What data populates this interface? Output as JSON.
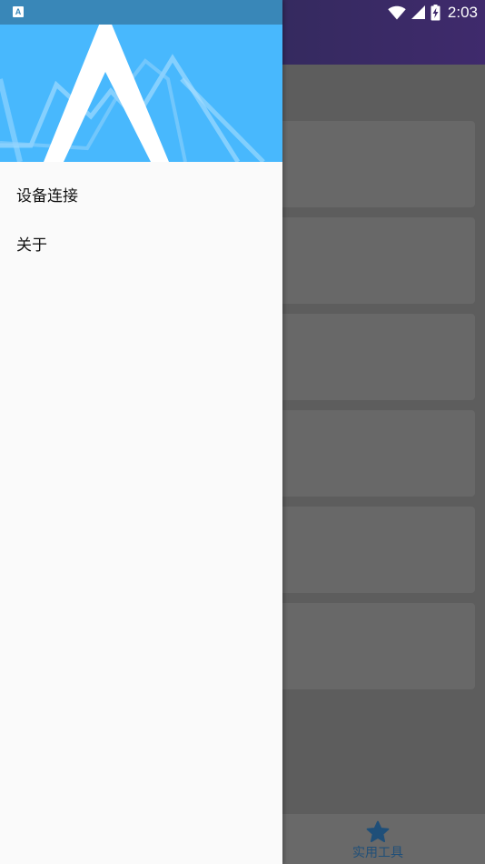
{
  "status_bar": {
    "notification_icon_label": "A",
    "time": "2:03",
    "icons": [
      "wifi-icon",
      "signal-icon",
      "battery-charging-icon"
    ]
  },
  "drawer": {
    "menu_items": [
      {
        "label": "设备连接"
      },
      {
        "label": "关于"
      }
    ]
  },
  "bottom_nav": {
    "tabs": [
      {
        "label": "实用工具",
        "icon": "star-icon"
      }
    ]
  },
  "colors": {
    "drawer_header": "#48b8fd",
    "status_bar_left": "#3987b8",
    "toolbar_accent": "#342a5e",
    "scrim_content": "#5d5d5d",
    "card": "#686868",
    "nav_active": "#1f4f79"
  }
}
